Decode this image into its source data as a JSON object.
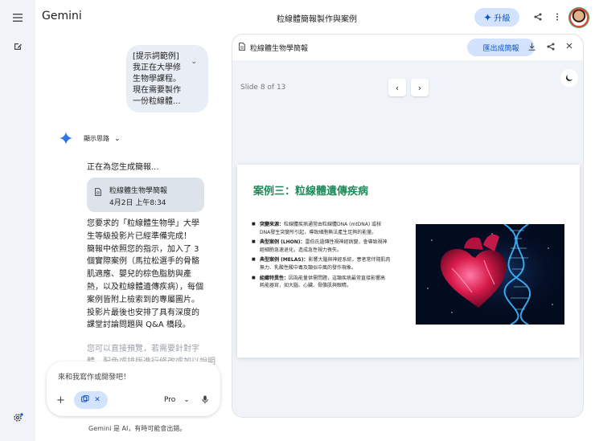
{
  "app": {
    "name": "Gemini",
    "document_title": "粒線體簡報製作與案例",
    "upgrade_label": "升級"
  },
  "icons": {
    "menu": "hamburger-menu-icon",
    "new_chat": "edit-icon",
    "settings": "settings-gear-icon",
    "share": "share-icon",
    "more": "more-vertical-icon",
    "sparkle": "gemini-sparkle-icon"
  },
  "colors": {
    "accent": "#0b57d0",
    "chip_bg": "#d3e3fd",
    "slide_title": "#1e8a5a"
  },
  "chat": {
    "user_prompt_lines": [
      "[提示詞範例]",
      "我正在大學修",
      "生物學課程。",
      "現在需要製作",
      "一份粒線體..."
    ],
    "thinking_label": "顯示思路",
    "generating_text": "正在為您生成簡報...",
    "doc_chip": {
      "title": "粒線體生物學簡報",
      "date": "4月2日 上午8:34"
    },
    "reply_lines": [
      "您要求的「粒線體生物學」大學",
      "生等級投影片已經準備完成！",
      "簡報中依照您的指示，加入了 3",
      "個實際案例（馬拉松選手的骨骼",
      "肌適應、嬰兒的棕色脂肪與產",
      "熱，以及粒線體遺傳疾病），每個",
      "案例皆附上檢索到的專屬圖片。",
      "投影片最後也安排了具有深度的",
      "課堂討論問題與 Q&A 橋段。"
    ],
    "reply_faded_lines": [
      "您可以直接預覽，若需要針對字",
      "體、配色或排版進行修改或加以說明"
    ]
  },
  "composer": {
    "placeholder": "來和我寫作或開發吧！",
    "model_label": "Pro"
  },
  "footer_note": "Gemini 是 AI，有時可能會出錯。",
  "panel": {
    "title": "粒線體生物學簡報",
    "export_label": "匯出成簡報",
    "slide_indicator": "Slide 8 of 13",
    "slide": {
      "title": "案例三：粒線體遺傳疾病",
      "bullets": [
        {
          "term": "突變來源：",
          "lines": [
            "粒線體疾病通常由粒線體DNA (mtDNA) 或核",
            "DNA發生突變所引起，導致細胞無法產生足夠的能量。"
          ]
        },
        {
          "term": "典型案例 (LHON)：",
          "lines": [
            "雷伯氏遺傳性視神經病變，會導致視神",
            "經細胞急速退化，造成急性視力喪失。"
          ]
        },
        {
          "term": "典型案例 (MELAS)：",
          "lines": [
            "影響大腦與神經系統，患者常伴隨肌肉",
            "無力、乳酸性酸中毒及類似中風的發作現象。"
          ]
        },
        {
          "term": "組織特異性：",
          "lines": [
            "因為能量供需問題，這類疾病最常直接影響高",
            "耗能器官，如大腦、心臟、骨骼肌與眼睛。"
          ]
        }
      ]
    }
  }
}
